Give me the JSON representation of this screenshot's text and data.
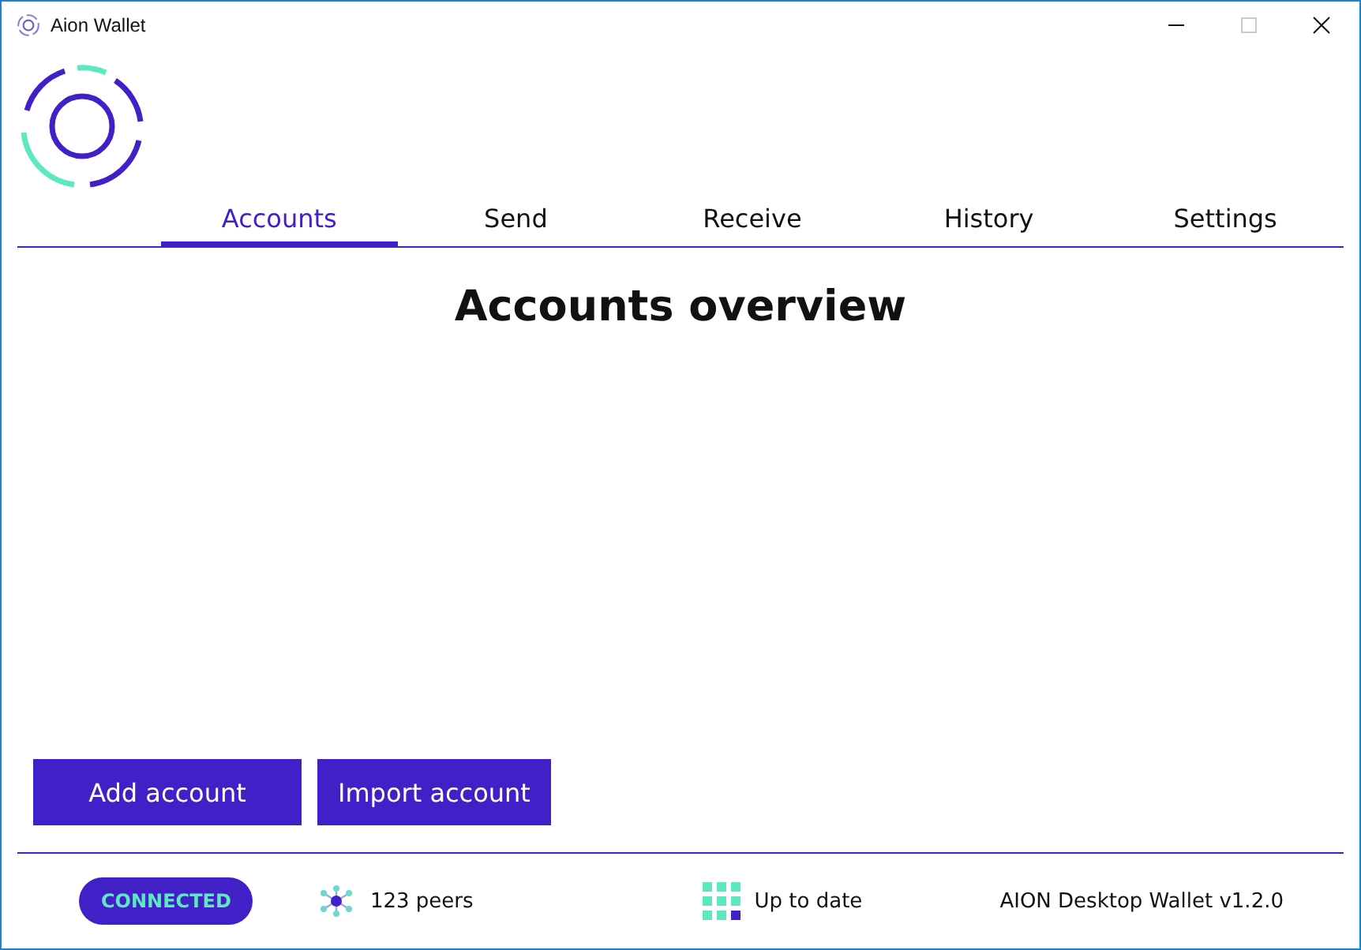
{
  "window": {
    "title": "Aion Wallet"
  },
  "tabs": [
    {
      "label": "Accounts",
      "selected": true
    },
    {
      "label": "Send",
      "selected": false
    },
    {
      "label": "Receive",
      "selected": false
    },
    {
      "label": "History",
      "selected": false
    },
    {
      "label": "Settings",
      "selected": false
    }
  ],
  "heading": "Accounts overview",
  "buttons": [
    "Add account",
    "Import account"
  ],
  "status_bar": {
    "connection": "CONNECTED",
    "peers": "123 peers",
    "sync": "Up to date",
    "version": "AION Desktop Wallet v1.2.0"
  }
}
